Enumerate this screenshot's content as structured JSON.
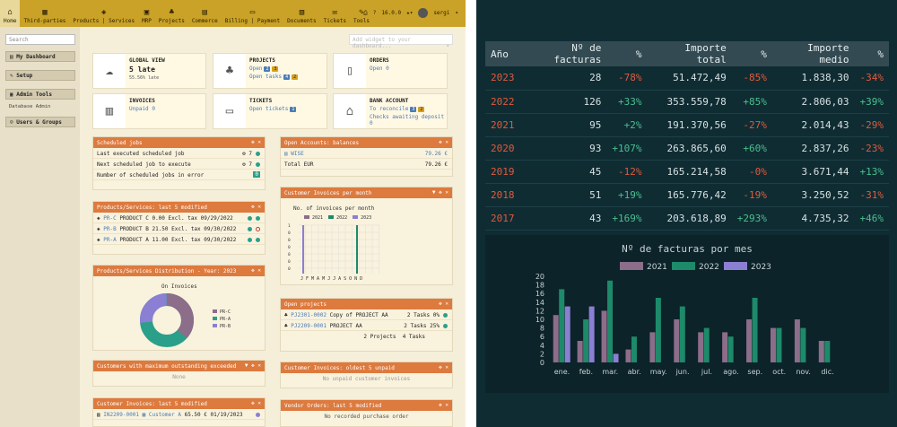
{
  "topbar": {
    "nav": [
      {
        "label": "Home",
        "icon": "home-icon",
        "glyph": "⌂"
      },
      {
        "label": "Third-parties",
        "icon": "building-icon",
        "glyph": "▦"
      },
      {
        "label": "Products | Services",
        "icon": "cube-icon",
        "glyph": "◈"
      },
      {
        "label": "MRP",
        "icon": "cubes-icon",
        "glyph": "▣"
      },
      {
        "label": "Projects",
        "icon": "sitemap-icon",
        "glyph": "♣"
      },
      {
        "label": "Commerce",
        "icon": "suitcase-icon",
        "glyph": "▤"
      },
      {
        "label": "Billing | Payment",
        "icon": "money-icon",
        "glyph": "▭"
      },
      {
        "label": "Documents",
        "icon": "folder-icon",
        "glyph": "▧"
      },
      {
        "label": "Tickets",
        "icon": "ticket-icon",
        "glyph": "✉"
      },
      {
        "label": "Tools",
        "icon": "wrench-icon",
        "glyph": "✎"
      }
    ],
    "version": "16.0.0",
    "username": "sergi"
  },
  "sidebar": {
    "search_placeholder": "Search",
    "items": [
      {
        "label": "My Dashboard"
      },
      {
        "label": "Setup"
      },
      {
        "label": "Admin Tools"
      },
      {
        "label": "Users & Groups"
      }
    ],
    "sub_label": "Database Admin"
  },
  "add_widget_placeholder": "Add widget to your dashboard...",
  "stats": {
    "global": {
      "title": "GLOBAL VIEW",
      "value": "5 late",
      "sub": "55.56% late"
    },
    "projects": {
      "title": "PROJECTS",
      "open": "Open",
      "open_count": "2",
      "open_late": "3",
      "tasks": "Open tasks",
      "tasks_count": "4",
      "tasks_late": "2"
    },
    "orders": {
      "title": "ORDERS",
      "open": "Open",
      "open_count": "0"
    },
    "invoices": {
      "title": "INVOICES",
      "unpaid": "Unpaid",
      "unpaid_count": "0"
    },
    "tickets": {
      "title": "TICKETS",
      "open": "Open tickets",
      "open_count": "1"
    },
    "bank": {
      "title": "BANK ACCOUNT",
      "reconcile": "To reconcile",
      "reconcile_count": "3",
      "reconcile_late": "2",
      "checks": "Checks awaiting deposit",
      "checks_count": "0"
    }
  },
  "scheduled": {
    "title": "Scheduled jobs",
    "rows": [
      {
        "label": "Last executed scheduled job",
        "value": "7"
      },
      {
        "label": "Next scheduled job to execute",
        "value": "7"
      },
      {
        "label": "Number of scheduled jobs in error",
        "value": "0"
      }
    ]
  },
  "open_accounts": {
    "title": "Open Accounts: balances",
    "rows": [
      {
        "label": "WISE",
        "value": "79.26 €"
      },
      {
        "label": "Total EUR",
        "value": "79.26 €"
      }
    ]
  },
  "products_modified": {
    "title": "Products/Services: last 5 modified",
    "rows": [
      {
        "ref": "PR-C",
        "name": "PRODUCT C",
        "price": "0.00",
        "tax": "Excl. tax",
        "date": "09/29/2022"
      },
      {
        "ref": "PR-B",
        "name": "PRODUCT B",
        "price": "21.50",
        "tax": "Excl. tax",
        "date": "09/30/2022"
      },
      {
        "ref": "PR-A",
        "name": "PRODUCT A",
        "price": "11.00",
        "tax": "Excl. tax",
        "date": "09/30/2022"
      }
    ]
  },
  "customer_invoices_month": {
    "title": "Customer Invoices per month",
    "chart_title": "No. of invoices per month",
    "legend": [
      "2021",
      "2022",
      "2023"
    ],
    "months": [
      "J",
      "F",
      "M",
      "A",
      "M",
      "J",
      "J",
      "A",
      "S",
      "O",
      "N",
      "D"
    ]
  },
  "distribution": {
    "title": "Products/Services Distribution - Year: 2023",
    "chart_title": "On Invoices",
    "legend": [
      "PR-C",
      "PR-A",
      "PR-B"
    ]
  },
  "open_projects": {
    "title": "Open projects",
    "rows": [
      {
        "ref": "PJ2301-0002",
        "name": "Copy of PROJECT AA",
        "tasks": "2 Tasks",
        "pct": "0%"
      },
      {
        "ref": "PJ2209-0001",
        "name": "PROJECT AA",
        "tasks": "2 Tasks",
        "pct": "25%"
      }
    ],
    "total_projects": "2 Projects",
    "total_tasks": "4 Tasks"
  },
  "max_outstanding": {
    "title": "Customers with maximum outstanding exceeded",
    "empty": "None"
  },
  "oldest_unpaid": {
    "title": "Customer Invoices: oldest 5 unpaid",
    "empty": "No unpaid customer invoices"
  },
  "invoices_modified": {
    "title": "Customer Invoices: last 5 modified",
    "rows": [
      {
        "ref": "IN2209-0001",
        "customer": "Customer A",
        "amount": "65.50 €",
        "date": "01/19/2023"
      }
    ]
  },
  "vendor_orders": {
    "title": "Vendor Orders: last 5 modified",
    "empty": "No recorded purchase order"
  },
  "yearly_table": {
    "headers": [
      "Año",
      "Nº de facturas",
      "%",
      "Importe total",
      "%",
      "Importe medio",
      "%"
    ],
    "rows": [
      {
        "year": "2023",
        "count": "28",
        "count_pct": "-78%",
        "total": "51.472,49",
        "total_pct": "-85%",
        "avg": "1.838,30",
        "avg_pct": "-34%"
      },
      {
        "year": "2022",
        "count": "126",
        "count_pct": "+33%",
        "total": "353.559,78",
        "total_pct": "+85%",
        "avg": "2.806,03",
        "avg_pct": "+39%"
      },
      {
        "year": "2021",
        "count": "95",
        "count_pct": "+2%",
        "total": "191.370,56",
        "total_pct": "-27%",
        "avg": "2.014,43",
        "avg_pct": "-29%"
      },
      {
        "year": "2020",
        "count": "93",
        "count_pct": "+107%",
        "total": "263.865,60",
        "total_pct": "+60%",
        "avg": "2.837,26",
        "avg_pct": "-23%"
      },
      {
        "year": "2019",
        "count": "45",
        "count_pct": "-12%",
        "total": "165.214,58",
        "total_pct": "-0%",
        "avg": "3.671,44",
        "avg_pct": "+13%"
      },
      {
        "year": "2018",
        "count": "51",
        "count_pct": "+19%",
        "total": "165.776,42",
        "total_pct": "-19%",
        "avg": "3.250,52",
        "avg_pct": "-31%"
      },
      {
        "year": "2017",
        "count": "43",
        "count_pct": "+169%",
        "total": "203.618,89",
        "total_pct": "+293%",
        "avg": "4.735,32",
        "avg_pct": "+46%"
      }
    ]
  },
  "chart_data": {
    "type": "bar",
    "title": "Nº de facturas por mes",
    "categories": [
      "ene.",
      "feb.",
      "mar.",
      "abr.",
      "may.",
      "jun.",
      "jul.",
      "ago.",
      "sep.",
      "oct.",
      "nov.",
      "dic."
    ],
    "series": [
      {
        "name": "2021",
        "color": "#8c6d8a",
        "values": [
          11,
          5,
          12,
          3,
          7,
          10,
          7,
          7,
          10,
          8,
          10,
          5
        ]
      },
      {
        "name": "2022",
        "color": "#1d8a6a",
        "values": [
          17,
          10,
          19,
          6,
          15,
          13,
          8,
          6,
          15,
          8,
          8,
          5
        ]
      },
      {
        "name": "2023",
        "color": "#8b7fd4",
        "values": [
          13,
          13,
          2,
          0,
          0,
          0,
          0,
          0,
          0,
          0,
          0,
          0
        ]
      }
    ],
    "ylim": [
      0,
      20
    ],
    "yticks": [
      0,
      2,
      4,
      6,
      8,
      10,
      12,
      14,
      16,
      18,
      20
    ],
    "legend": "top-center",
    "grid": false
  }
}
